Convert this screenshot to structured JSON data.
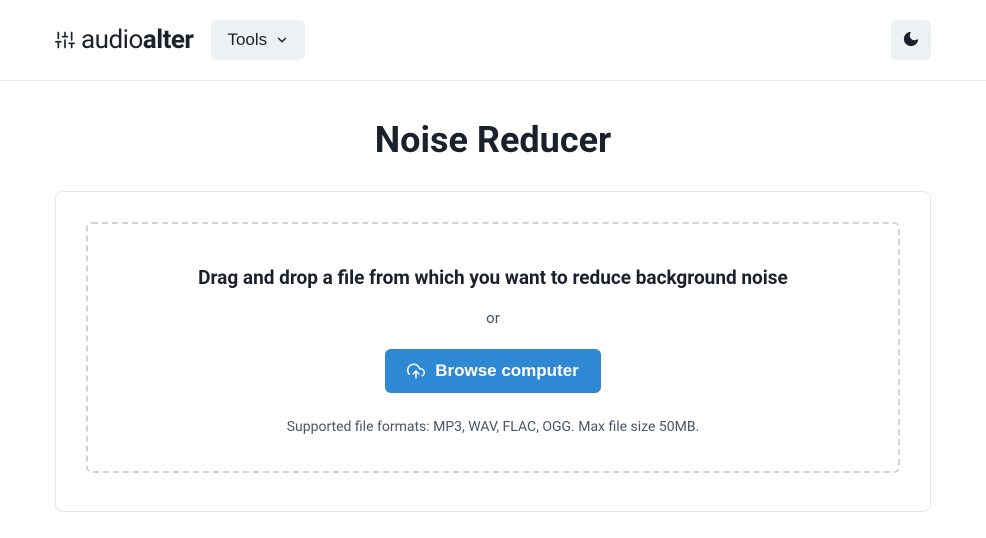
{
  "header": {
    "logo": {
      "prefix": "audio",
      "suffix": "alter"
    },
    "tools_label": "Tools"
  },
  "page": {
    "title": "Noise Reducer"
  },
  "dropzone": {
    "instruction": "Drag and drop a file from which you want to reduce background noise",
    "or_label": "or",
    "browse_label": "Browse computer",
    "supported_text": "Supported file formats: MP3, WAV, FLAC, OGG. Max file size 50MB."
  }
}
